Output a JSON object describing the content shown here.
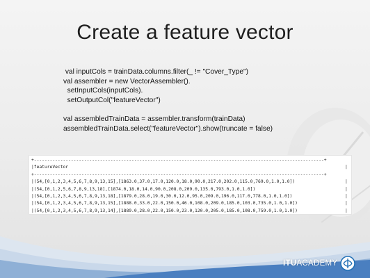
{
  "slide": {
    "title": "Create a feature vector",
    "code_lines": [
      " val inputCols = trainData.columns.filter(_ != \"Cover_Type\")",
      "val assembler = new VectorAssembler().",
      "  setInputCols(inputCols).",
      "  setOutputCol(\"featureVector\")",
      "",
      "val assembledTrainData = assembler.transform(trainData)",
      "assembledTrainData.select(\"featureVector\").show(truncate = false)"
    ],
    "output": {
      "border_top": "+--------------------------------------------------------------------------------------------------------------+",
      "header": "|featureVector",
      "border_mid": "+--------------------------------------------------------------------------------------------------------------+",
      "rows": [
        "|(54,[0,1,2,3,4,5,6,7,8,9,13,15],[1863.0,37.0,17.0,120.0,18.0,90.0,217.0,202.0,115.0,769.0,1.0,1.0])",
        "|(54,[0,1,2,5,6,7,8,9,13,18],[1874.0,18.0,14.0,90.0,208.0,209.0,135.0,793.0,1.0,1.0])",
        "|(54,[0,1,2,3,4,5,6,7,8,9,13,18],[1879.0,28.0,19.0,30.0,12.0,95.0,209.0,196.0,117.0,778.0,1.0,1.0])",
        "|(54,[0,1,2,3,4,5,6,7,8,9,13,15],[1888.0,33.0,22.0,150.0,46.0,108.0,209.0,185.0,103.0,735.0,1.0,1.0])",
        "|(54,[0,1,2,3,4,5,6,7,8,9,13,14],[1889.0,28.0,22.0,150.0,23.0,120.0,205.0,185.0,108.0,759.0,1.0,1.0])"
      ],
      "pipe": "|"
    },
    "logo": {
      "text_bold": "ITU",
      "text_regular": "ACADEMY",
      "emblem_color": "#1f6fb5"
    },
    "colors": {
      "wave_blue": "#4a7fc0",
      "wave_light": "#c9d8ea"
    }
  }
}
